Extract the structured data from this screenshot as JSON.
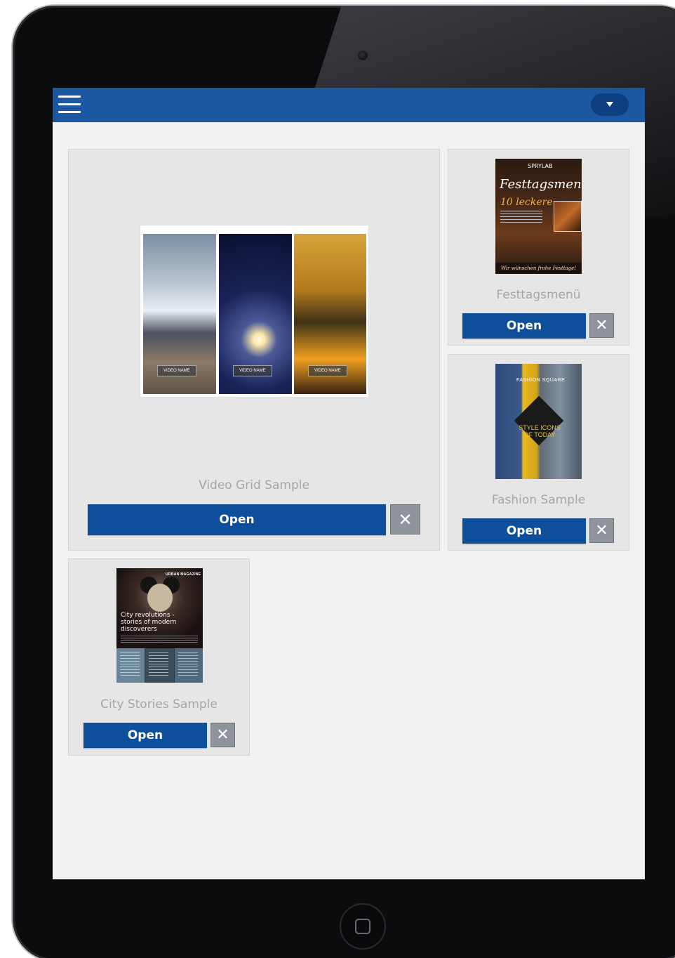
{
  "app": {
    "menu_icon": "hamburger-menu-icon",
    "dropdown_icon": "caret-down-icon",
    "colors": {
      "header": "#1c58a1",
      "button": "#0d4f9a",
      "close_button": "#8f949c",
      "background": "#f1f1f1",
      "card": "#e6e6e6"
    }
  },
  "cards": [
    {
      "title": "Video Grid Sample",
      "open_label": "Open",
      "close_icon": "close-icon",
      "close_glyph": "✕",
      "thumbnail": {
        "video_labels": [
          "VIDEO NAME",
          "VIDEO NAME",
          "VIDEO NAME"
        ]
      }
    },
    {
      "title": "Festtagsmenü",
      "open_label": "Open",
      "close_icon": "close-icon",
      "close_glyph": "✕",
      "thumbnail": {
        "brand": "SPRYLAB",
        "title": "Festtagsmenü",
        "number_line": "10 leckere",
        "footer": "Wir wünschen frohe Festtage!"
      }
    },
    {
      "title": "Fashion Sample",
      "open_label": "Open",
      "close_icon": "close-icon",
      "close_glyph": "✕",
      "thumbnail": {
        "brand": "FASHION SQUARE",
        "headline": "STYLE ICONS OF TODAY"
      }
    },
    {
      "title": "City Stories Sample",
      "open_label": "Open",
      "close_icon": "close-icon",
      "close_glyph": "✕",
      "thumbnail": {
        "brand": "URBAN MAGAZINE",
        "headline": "City revolutions - stories of modern discoverers"
      }
    }
  ]
}
